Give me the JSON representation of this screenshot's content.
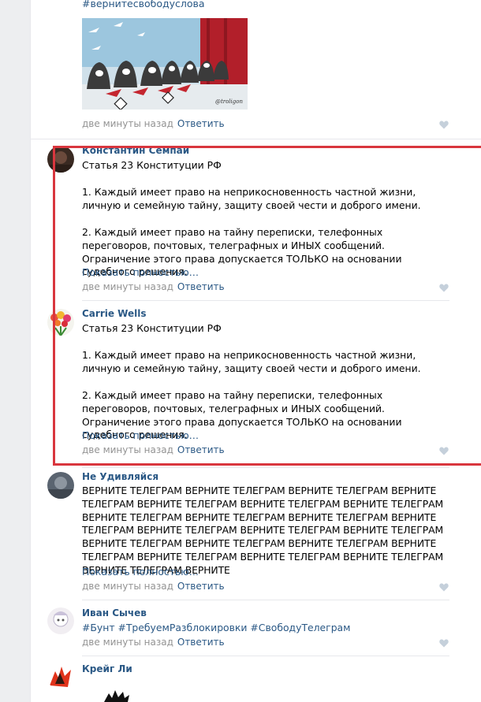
{
  "top_post": {
    "hashtag": "#вернитесвободуслова",
    "image_signature": "@troligon",
    "time": "две минуты назад",
    "reply": "Ответить"
  },
  "comments": [
    {
      "author": "Константин Семпаи",
      "title": "Статья 23 Конституции РФ",
      "p1": "1. Каждый имеет право на неприкосновенность частной жизни, личную и семейную тайну, защиту своей чести и доброго имени.",
      "p2": "2. Каждый имеет право на тайну переписки, телефонных переговоров, почтовых, телеграфных и ИНЫХ сообщений. Ограничение этого права допускается ТОЛЬКО на основании судебного решения.",
      "more": "Показать полностью…",
      "time": "две минуты назад",
      "reply": "Ответить"
    },
    {
      "author": "Carrie Wells",
      "title": "Статья 23 Конституции РФ",
      "p1": "1. Каждый имеет право на неприкосновенность частной жизни, личную и семейную тайну, защиту своей чести и доброго имени.",
      "p2": "2. Каждый имеет право на тайну переписки, телефонных переговоров, почтовых, телеграфных и ИНЫХ сообщений. Ограничение этого права допускается ТОЛЬКО на основании судебного решения.",
      "more": "Показать полностью…",
      "time": "две минуты назад",
      "reply": "Ответить"
    },
    {
      "author": "Не Удивляйся",
      "text": "ВЕРНИТЕ ТЕЛЕГРАМ ВЕРНИТЕ ТЕЛЕГРАМ ВЕРНИТЕ ТЕЛЕГРАМ ВЕРНИТЕ ТЕЛЕГРАМ ВЕРНИТЕ ТЕЛЕГРАМ ВЕРНИТЕ ТЕЛЕГРАМ ВЕРНИТЕ ТЕЛЕГРАМ ВЕРНИТЕ ТЕЛЕГРАМ ВЕРНИТЕ ТЕЛЕГРАМ ВЕРНИТЕ ТЕЛЕГРАМ ВЕРНИТЕ ТЕЛЕГРАМ ВЕРНИТЕ ТЕЛЕГРАМ ВЕРНИТЕ ТЕЛЕГРАМ ВЕРНИТЕ ТЕЛЕГРАМ ВЕРНИТЕ ТЕЛЕГРАМ ВЕРНИТЕ ТЕЛЕГРАМ ВЕРНИТЕ ТЕЛЕГРАМ ВЕРНИТЕ ТЕЛЕГРАМ ВЕРНИТЕ ТЕЛЕГРАМ ВЕРНИТЕ ТЕЛЕГРАМ ВЕРНИТЕ ТЕЛЕГРАМ ВЕРНИТЕ ТЕЛЕГРАМ ВЕРНИТЕ",
      "more": "Показать полностью…",
      "time": "две минуты назад",
      "reply": "Ответить"
    },
    {
      "author": "Иван Сычев",
      "hashtags": "#Бунт #ТребуемРазблокировки #СвободуТелеграм",
      "time": "две минуты назад",
      "reply": "Ответить"
    },
    {
      "author": "Крейг Ли"
    }
  ],
  "colors": {
    "link": "#2a5885",
    "meta": "#939393",
    "highlight": "#d9363e",
    "background": "#edeef0"
  },
  "icons": {
    "like": "heart-icon"
  }
}
